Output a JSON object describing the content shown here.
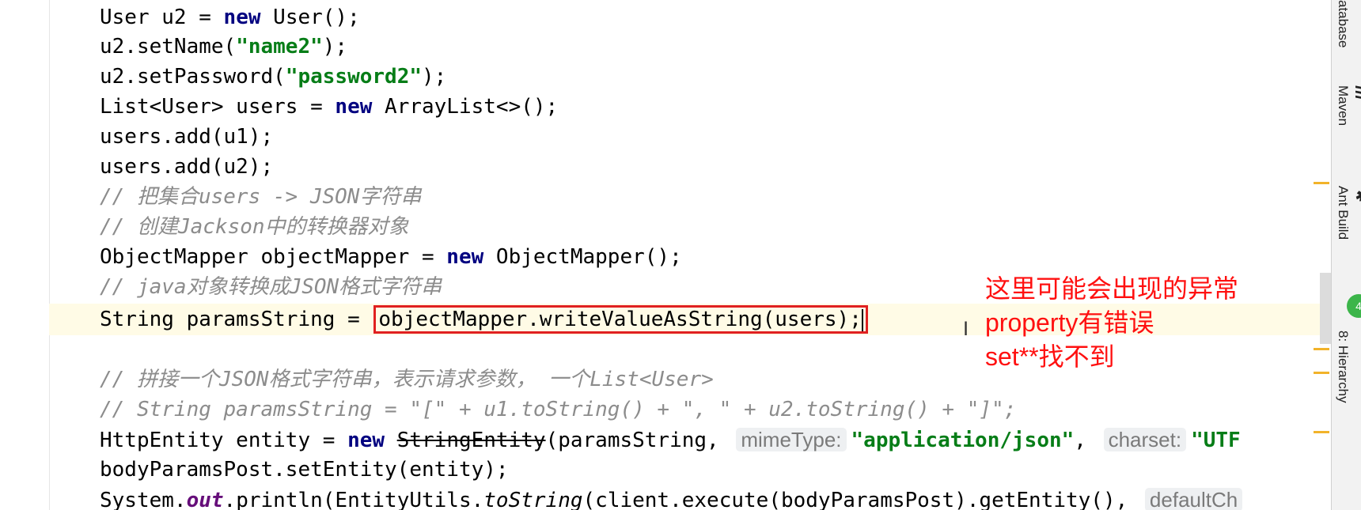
{
  "code": {
    "line1": {
      "a": "User u2 = ",
      "kw": "new",
      "b": " User();"
    },
    "line2": {
      "a": "u2.setName(",
      "s": "\"name2\"",
      "b": ");"
    },
    "line3": {
      "a": "u2.setPassword(",
      "s": "\"password2\"",
      "b": ");"
    },
    "line4": {
      "a": "List<User> users = ",
      "kw": "new",
      "b": " ArrayList<>();"
    },
    "line5": "users.add(u1);",
    "line6": "users.add(u2);",
    "line7": "// 把集合users -> JSON字符串",
    "line8": "// 创建Jackson中的转换器对象",
    "line9": {
      "a": "ObjectMapper objectMapper = ",
      "kw": "new",
      "b": " ObjectMapper();"
    },
    "line10": "// java对象转换成JSON格式字符串",
    "line11": {
      "a": "String paramsString = ",
      "boxed": "objectMapper.writeValueAsString(users);"
    },
    "line12": "// 拼接一个JSON格式字符串，表示请求参数， 一个List<User>",
    "line13": "// String paramsString = \"[\" + u1.toString() + \", \" + u2.toString() + \"]\";",
    "line14": {
      "a": "HttpEntity entity = ",
      "kw": "new",
      "strike": "StringEntity",
      "b": "(paramsString, ",
      "hint1": "mimeType:",
      "s1": "\"application/json\"",
      "c": ", ",
      "hint2": "charset:",
      "s2": "\"UTF"
    },
    "line15": "bodyParamsPost.setEntity(entity);",
    "line16": {
      "a": "System.",
      "field": "out",
      "b": ".println(EntityUtils.",
      "method": "toString",
      "c": "(client.execute(bodyParamsPost).getEntity(), ",
      "hint": "defaultCh"
    }
  },
  "annotation": {
    "line1": "这里可能会出现的异常",
    "line2": "property有错误",
    "line3": "set**找不到"
  },
  "sidebar": {
    "database": "atabase",
    "maven_icon": "m",
    "maven": "Maven",
    "ant_icon": "✱",
    "ant": "Ant Build",
    "hierarchy": "8: Hierarchy"
  },
  "badge": "4",
  "colors": {
    "annotation": "#ff1010",
    "highlight_box": "#e02020",
    "keyword": "#000080",
    "string": "#067d17",
    "comment": "#8c8c8c"
  }
}
